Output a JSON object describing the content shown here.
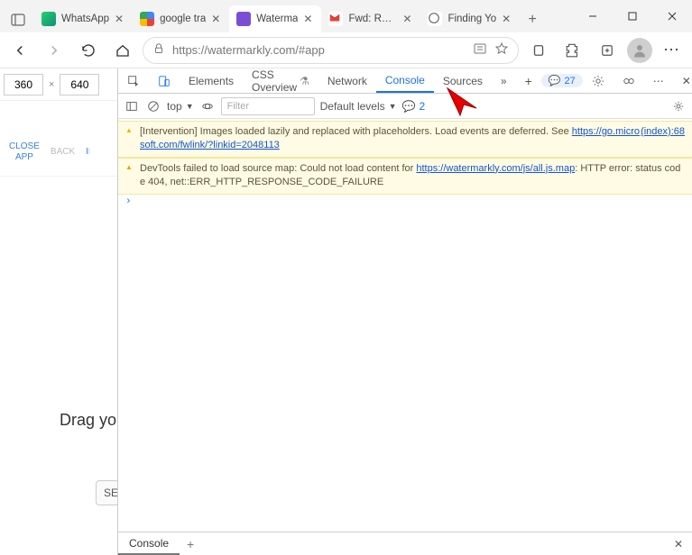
{
  "browser": {
    "tabs": [
      {
        "label": "WhatsApp",
        "favicon": "wafav"
      },
      {
        "label": "google tra",
        "favicon": "gfav"
      },
      {
        "label": "Waterma",
        "favicon": "shieldfav",
        "active": true
      },
      {
        "label": "Fwd: Re: C",
        "favicon": "mfav"
      },
      {
        "label": "Finding Yo",
        "favicon": "efav"
      }
    ],
    "url_display": "https://watermarkly.com/#app",
    "url_host": "watermarkly.com"
  },
  "page": {
    "viewport_w": "360",
    "viewport_h": "640",
    "size_sep": "×",
    "close_app": "CLOSE\nAPP",
    "back": "BACK",
    "im": "IM",
    "drag_text": "Drag yo",
    "select_label": "SE"
  },
  "devtools": {
    "tabs": {
      "elements": "Elements",
      "css_overview": "CSS Overview",
      "network": "Network",
      "console": "Console",
      "sources": "Sources"
    },
    "issues_count": "27",
    "toolbar": {
      "context": "top",
      "filter_placeholder": "Filter",
      "levels": "Default levels",
      "issue_count": "2"
    },
    "messages": {
      "m1_a": "[Intervention] Images loaded lazily and replaced with placeholders. Load events are deferred. See ",
      "m1_link": "https://go.microsoft.com/fwlink/?linkid=2048113",
      "m1_src": "(index):68",
      "m2_a": "DevTools failed to load source map: Could not load content for ",
      "m2_link": "https://watermarkly.com/js/all.js.map",
      "m2_b": ": HTTP error: status code 404, net::ERR_HTTP_RESPONSE_CODE_FAILURE"
    },
    "drawer": {
      "console": "Console"
    }
  }
}
